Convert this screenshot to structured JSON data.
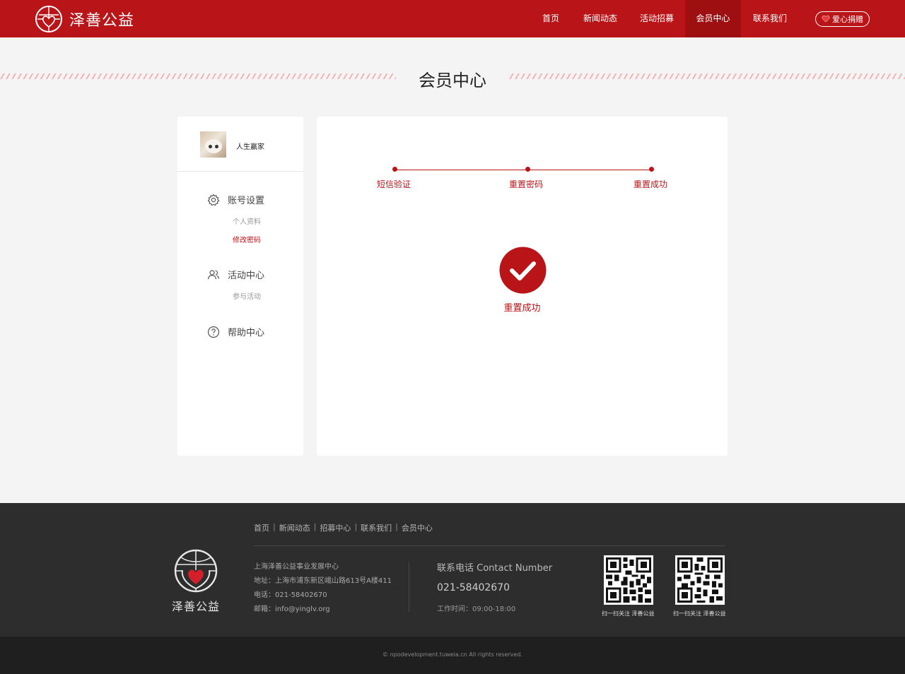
{
  "header": {
    "logo_text": "泽善公益",
    "nav": [
      {
        "label": "首页",
        "active": false
      },
      {
        "label": "新闻动态",
        "active": false
      },
      {
        "label": "活动招募",
        "active": false
      },
      {
        "label": "会员中心",
        "active": true
      },
      {
        "label": "联系我们",
        "active": false
      }
    ],
    "donate_label": "爱心捐赠",
    "brand_color": "#b91518"
  },
  "page_title": "会员中心",
  "sidebar": {
    "username": "人生赢家",
    "groups": [
      {
        "label": "账号设置",
        "icon": "gear-icon",
        "items": [
          {
            "label": "个人资料",
            "active": false
          },
          {
            "label": "修改密码",
            "active": true
          }
        ]
      },
      {
        "label": "活动中心",
        "icon": "people-icon",
        "items": [
          {
            "label": "参与活动",
            "active": false
          }
        ]
      },
      {
        "label": "帮助中心",
        "icon": "help-icon",
        "items": []
      }
    ]
  },
  "steps": [
    "短信验证",
    "重置密码",
    "重置成功"
  ],
  "result": {
    "icon": "check-circle-icon",
    "text": "重置成功"
  },
  "footer": {
    "links": [
      "首页",
      "新闻动态",
      "招募中心",
      "联系我们",
      "会员中心"
    ],
    "logo_text": "泽善公益",
    "org": "上海泽善公益事业发展中心",
    "address": "地址：上海市浦东新区峨山路613号A楼411",
    "phone_line": "电话：021-58402670",
    "email_line": "邮箱：info@yinglv.org",
    "contact_title": "联系电话 Contact Number",
    "contact_phone": "021-58402670",
    "work_time": "工作时间：09:00-18:00",
    "qr_label_1": "扫一扫关注 泽善公益",
    "qr_label_2": "扫一扫关注 泽善公益",
    "copyright": "© npodevelopment.tuweia.cn All rights reserved."
  }
}
